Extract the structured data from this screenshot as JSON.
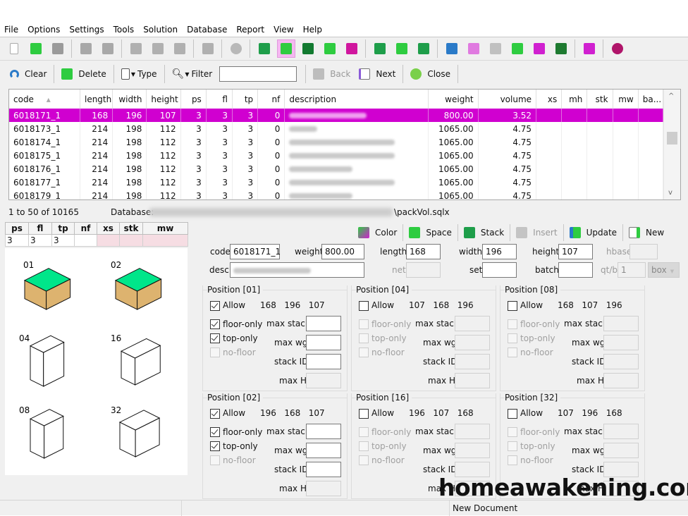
{
  "menu": [
    "File",
    "Options",
    "Settings",
    "Tools",
    "Solution",
    "Database",
    "Report",
    "View",
    "Help"
  ],
  "toolbar_icons": [
    {
      "name": "new-file-icon",
      "color": "#e8e8e8"
    },
    {
      "name": "open-folder-icon",
      "color": "#2ecc40"
    },
    {
      "name": "save-icon",
      "color": "#9a9a9a"
    },
    {
      "sep": true
    },
    {
      "name": "copy-icon",
      "color": "#a8a8a8"
    },
    {
      "name": "paste-icon",
      "color": "#a8a8a8"
    },
    {
      "sep": true
    },
    {
      "name": "refresh-doc-icon",
      "color": "#b0b0b0"
    },
    {
      "name": "tools-icon",
      "color": "#b0b0b0"
    },
    {
      "name": "chart-icon",
      "color": "#b0b0b0"
    },
    {
      "sep": true
    },
    {
      "name": "layers-dropdown-icon",
      "color": "#b0b0b0"
    },
    {
      "sep": true
    },
    {
      "name": "gear-icon",
      "color": "#b8b8b8"
    },
    {
      "sep": true
    },
    {
      "name": "import-icon",
      "color": "#1e9e4a"
    },
    {
      "name": "edit-icon",
      "color": "#2ecc40",
      "selected": true
    },
    {
      "name": "export-icon",
      "color": "#127a30"
    },
    {
      "name": "container-icon",
      "color": "#2ecc40"
    },
    {
      "name": "pallet-icon",
      "color": "#d0169e"
    },
    {
      "sep": true
    },
    {
      "name": "load-icon",
      "color": "#1e9e4a"
    },
    {
      "name": "hierarchy-icon",
      "color": "#2ecc40"
    },
    {
      "name": "list-icon",
      "color": "#1e9e4a"
    },
    {
      "sep": true
    },
    {
      "name": "sync-icon",
      "color": "#2a7ac8"
    },
    {
      "name": "grid-view-icon",
      "color": "#e07ae0"
    },
    {
      "name": "hand-icon",
      "color": "#c0c0c0"
    },
    {
      "name": "swap-icon",
      "color": "#2ecc40"
    },
    {
      "name": "color-dropdown-icon",
      "color": "#d020d0"
    },
    {
      "name": "table-icon",
      "color": "#1e7a30"
    },
    {
      "sep": true
    },
    {
      "name": "fit-icon",
      "color": "#d020d0"
    },
    {
      "sep": true
    },
    {
      "name": "help-icon",
      "color": "#b0156a"
    }
  ],
  "actions": {
    "clear": "Clear",
    "delete": "Delete",
    "type": "Type",
    "filter": "Filter",
    "filter_value": "",
    "back": "Back",
    "next": "Next",
    "close": "Close"
  },
  "grid": {
    "columns": [
      "code",
      "length",
      "width",
      "height",
      "ps",
      "fl",
      "tp",
      "nf",
      "description",
      "weight",
      "volume",
      "xs",
      "mh",
      "stk",
      "mw",
      "ba..."
    ],
    "sort_column": "code",
    "rows": [
      {
        "code": "6018171_1",
        "length": "168",
        "width": "196",
        "height": "107",
        "ps": "3",
        "fl": "3",
        "tp": "3",
        "nf": "0",
        "weight": "800.00",
        "volume": "3.52",
        "selected": true
      },
      {
        "code": "6018173_1",
        "length": "214",
        "width": "198",
        "height": "112",
        "ps": "3",
        "fl": "3",
        "tp": "3",
        "nf": "0",
        "weight": "1065.00",
        "volume": "4.75"
      },
      {
        "code": "6018174_1",
        "length": "214",
        "width": "198",
        "height": "112",
        "ps": "3",
        "fl": "3",
        "tp": "3",
        "nf": "0",
        "weight": "1065.00",
        "volume": "4.75"
      },
      {
        "code": "6018175_1",
        "length": "214",
        "width": "198",
        "height": "112",
        "ps": "3",
        "fl": "3",
        "tp": "3",
        "nf": "0",
        "weight": "1065.00",
        "volume": "4.75"
      },
      {
        "code": "6018176_1",
        "length": "214",
        "width": "198",
        "height": "112",
        "ps": "3",
        "fl": "3",
        "tp": "3",
        "nf": "0",
        "weight": "1065.00",
        "volume": "4.75"
      },
      {
        "code": "6018177_1",
        "length": "214",
        "width": "198",
        "height": "112",
        "ps": "3",
        "fl": "3",
        "tp": "3",
        "nf": "0",
        "weight": "1065.00",
        "volume": "4.75"
      },
      {
        "code": "6018179_1",
        "length": "214",
        "width": "198",
        "height": "112",
        "ps": "3",
        "fl": "3",
        "tp": "3",
        "nf": "0",
        "weight": "1065.00",
        "volume": "4.75"
      }
    ]
  },
  "status": {
    "record_range": "1 to 50 of 10165",
    "database_label": "Database:",
    "database_file": "\\packVol.sqlx"
  },
  "props_table": {
    "headers": [
      "ps",
      "fl",
      "tp",
      "nf",
      "xs",
      "stk",
      "mw"
    ],
    "values": [
      "3",
      "3",
      "3",
      "",
      "",
      "",
      ""
    ]
  },
  "orientations": [
    {
      "label": "01",
      "active": true
    },
    {
      "label": "02",
      "active": true
    },
    {
      "label": "04",
      "active": false
    },
    {
      "label": "16",
      "active": false
    },
    {
      "label": "08",
      "active": false
    },
    {
      "label": "32",
      "active": false
    }
  ],
  "detail_toolbar": {
    "color": "Color",
    "space": "Space",
    "stack": "Stack",
    "insert": "Insert",
    "update": "Update",
    "new": "New"
  },
  "form": {
    "code_label": "code",
    "code": "6018171_1",
    "weight_label": "weight",
    "weight": "800.00",
    "length_label": "length",
    "length": "168",
    "width_label": "width",
    "width": "196",
    "height_label": "height",
    "height": "107",
    "hbase_label": "hbase",
    "hbase": "",
    "desc_label": "desc.",
    "net_label": "net",
    "net": "",
    "set_label": "set",
    "set": "",
    "batch_label": "batch",
    "batch": "",
    "qtb_label": "qt/b",
    "qtb": "1",
    "unit": "box"
  },
  "positions": [
    {
      "title": "Position [01]",
      "allow": true,
      "dims": "168   196   107",
      "floor_only": true,
      "top_only": true,
      "no_floor": false,
      "enabled": true
    },
    {
      "title": "Position [04]",
      "allow": false,
      "dims": "107   168   196",
      "floor_only": false,
      "top_only": false,
      "no_floor": false,
      "enabled": false
    },
    {
      "title": "Position [08]",
      "allow": false,
      "dims": "168   107   196",
      "floor_only": false,
      "top_only": false,
      "no_floor": false,
      "enabled": false
    },
    {
      "title": "Position [02]",
      "allow": true,
      "dims": "196   168   107",
      "floor_only": true,
      "top_only": true,
      "no_floor": false,
      "enabled": true
    },
    {
      "title": "Position [16]",
      "allow": false,
      "dims": "196   107   168",
      "floor_only": false,
      "top_only": false,
      "no_floor": false,
      "enabled": false
    },
    {
      "title": "Position [32]",
      "allow": false,
      "dims": "107   196   168",
      "floor_only": false,
      "top_only": false,
      "no_floor": false,
      "enabled": false
    }
  ],
  "pos_labels": {
    "allow": "Allow",
    "floor_only": "floor-only",
    "top_only": "top-only",
    "no_floor": "no-floor",
    "max_stack": "max stack",
    "max_wg": "max wg",
    "stack_id": "stack ID",
    "max_h": "max H"
  },
  "statusbar": {
    "message": "New Document"
  },
  "watermark": "homeawakening.com",
  "colors": {
    "selection": "#d000d0",
    "box_top": "#00e68a",
    "box_side": "#ddb36f",
    "toolbar_selected": "#f4b8f0"
  }
}
